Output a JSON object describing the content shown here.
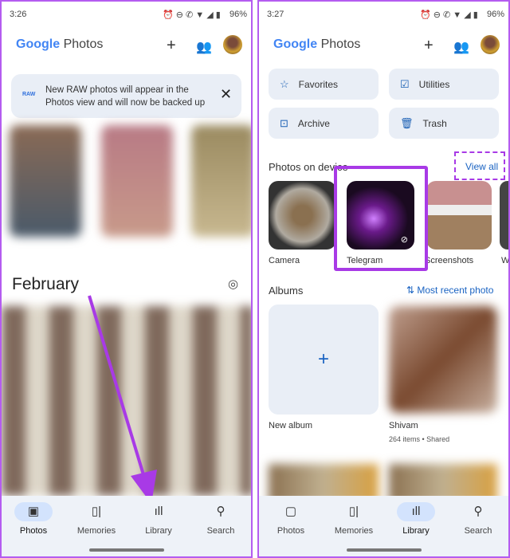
{
  "left": {
    "status": {
      "time": "3:26",
      "icons": "⏰ ⊖ ✆ ▼ ◢ ▮",
      "battery": "96%"
    },
    "app": {
      "logo_google": "Google",
      "logo_photos": "Photos"
    },
    "banner": {
      "badge": "RAW",
      "text": "New RAW photos will appear in the Photos view and will now be backed up"
    },
    "section_title": "February",
    "nav": [
      {
        "label": "Photos",
        "icon": "image-icon",
        "active": true
      },
      {
        "label": "Memories",
        "icon": "memories-icon"
      },
      {
        "label": "Library",
        "icon": "library-icon"
      },
      {
        "label": "Search",
        "icon": "search-icon"
      }
    ]
  },
  "right": {
    "status": {
      "time": "3:27",
      "icons": "⏰ ⊖ ✆ ▼ ◢ ▮",
      "battery": "96%"
    },
    "app": {
      "logo_google": "Google",
      "logo_photos": "Photos"
    },
    "chips": [
      {
        "label": "Favorites",
        "icon": "star-icon"
      },
      {
        "label": "Utilities",
        "icon": "utilities-icon"
      },
      {
        "label": "Archive",
        "icon": "archive-icon"
      },
      {
        "label": "Trash",
        "icon": "trash-icon"
      }
    ],
    "device": {
      "title": "Photos on device",
      "view_all": "View all",
      "folders": [
        "Camera",
        "Telegram",
        "Screenshots",
        "W"
      ]
    },
    "albums": {
      "title": "Albums",
      "sort": "Most recent photo",
      "new_album": "New album",
      "shivam": {
        "name": "Shivam",
        "meta": "264 items • Shared"
      }
    },
    "nav": [
      {
        "label": "Photos",
        "icon": "image-icon"
      },
      {
        "label": "Memories",
        "icon": "memories-icon"
      },
      {
        "label": "Library",
        "icon": "library-icon",
        "active": true
      },
      {
        "label": "Search",
        "icon": "search-icon"
      }
    ]
  },
  "colors": {
    "highlight": "#a83ae6",
    "link": "#1a63c2",
    "chip_bg": "#e9eef6",
    "nav_active": "#d3e3fd"
  }
}
